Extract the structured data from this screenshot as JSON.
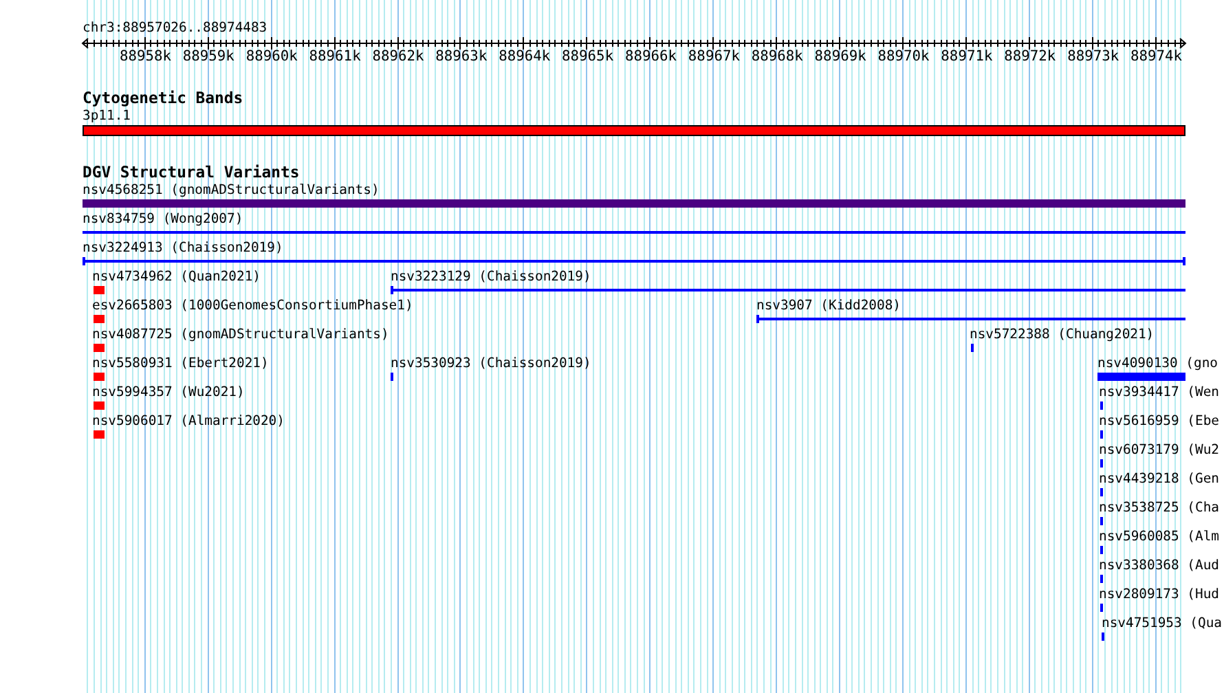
{
  "ruler": {
    "location": "chr3:88957026..88974483",
    "ticks": [
      "88958k",
      "88959k",
      "88960k",
      "88961k",
      "88962k",
      "88963k",
      "88964k",
      "88965k",
      "88966k",
      "88967k",
      "88968k",
      "88969k",
      "88970k",
      "88971k",
      "88972k",
      "88973k",
      "88974k"
    ]
  },
  "tracks": [
    {
      "title": "Cytogenetic Bands",
      "features": [
        {
          "label": "3p11.1",
          "kind": "band",
          "color": "#ff0000"
        }
      ]
    },
    {
      "title": "DGV Structural Variants",
      "features": [
        {
          "label": "nsv4568251 (gnomADStructuralVariants)",
          "kind": "bar",
          "color": "#4b0082"
        },
        {
          "label": "nsv834759 (Wong2007)",
          "kind": "line",
          "color": "#0000ff"
        },
        {
          "label": "nsv3224913 (Chaisson2019)",
          "kind": "span",
          "color": "#0000ff"
        },
        {
          "label": "nsv4734962 (Quan2021)",
          "kind": "block",
          "color": "#ff0000"
        },
        {
          "label": "nsv3223129 (Chaisson2019)",
          "kind": "halfspan",
          "color": "#0000ff"
        },
        {
          "label": "esv2665803 (1000GenomesConsortiumPhase1)",
          "kind": "block",
          "color": "#ff0000"
        },
        {
          "label": "nsv3907 (Kidd2008)",
          "kind": "halfspan",
          "color": "#0000ff"
        },
        {
          "label": "nsv4087725 (gnomADStructuralVariants)",
          "kind": "block",
          "color": "#ff0000"
        },
        {
          "label": "nsv5722388 (Chuang2021)",
          "kind": "tick",
          "color": "#0000ff"
        },
        {
          "label": "nsv5580931 (Ebert2021)",
          "kind": "block",
          "color": "#ff0000"
        },
        {
          "label": "nsv3530923 (Chaisson2019)",
          "kind": "tick",
          "color": "#0000ff"
        },
        {
          "label": "nsv4090130 (gno",
          "kind": "bar",
          "color": "#0000ff"
        },
        {
          "label": "nsv5994357 (Wu2021)",
          "kind": "block",
          "color": "#ff0000"
        },
        {
          "label": "nsv3934417 (Wen",
          "kind": "tick",
          "color": "#0000ff"
        },
        {
          "label": "nsv5906017 (Almarri2020)",
          "kind": "block",
          "color": "#ff0000"
        },
        {
          "label": "nsv5616959 (Ebe",
          "kind": "tick",
          "color": "#0000ff"
        },
        {
          "label": "nsv6073179 (Wu2",
          "kind": "tick",
          "color": "#0000ff"
        },
        {
          "label": "nsv4439218 (Gen",
          "kind": "tick",
          "color": "#0000ff"
        },
        {
          "label": "nsv3538725 (Cha",
          "kind": "tick",
          "color": "#0000ff"
        },
        {
          "label": "nsv5960085 (Alm",
          "kind": "tick",
          "color": "#0000ff"
        },
        {
          "label": "nsv3380368 (Aud",
          "kind": "tick",
          "color": "#0000ff"
        },
        {
          "label": "nsv2809173 (Hud",
          "kind": "tick",
          "color": "#0000ff"
        },
        {
          "label": "nsv4751953 (Qua",
          "kind": "tick",
          "color": "#0000ff"
        }
      ]
    }
  ]
}
